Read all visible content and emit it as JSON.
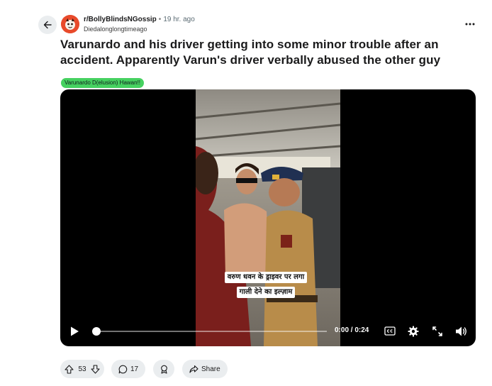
{
  "header": {
    "back_icon": "arrow-left-icon",
    "subreddit": "r/BollyBlindsNGossip",
    "separator": "•",
    "time_ago": "19 hr. ago",
    "username": "Diedalonglongtimeago",
    "more_icon": "ellipsis-icon"
  },
  "post": {
    "title": "Varunardo and his driver getting into some minor trouble after an accident. Apparently Varun's driver verbally abused the other guy",
    "flair": "Varunardo D(elusion) Hawan!!",
    "flair_color": "#46d160"
  },
  "video": {
    "caption_line1": "वरुण धवन के ड्राइवर पर लगा",
    "caption_line2": "गाली देने का इल्ज़ाम",
    "time_readout": "0:00 / 0:24",
    "progress": 0,
    "icons": [
      "play-icon",
      "closed-captions-icon",
      "gear-icon",
      "fullscreen-icon",
      "volume-icon"
    ]
  },
  "actions": {
    "upvotes": "53",
    "comments": "17",
    "share_label": "Share"
  },
  "colors": {
    "pill_bg": "#eaedef",
    "avatar": "#e84a2b",
    "video_bg": "#000000"
  }
}
